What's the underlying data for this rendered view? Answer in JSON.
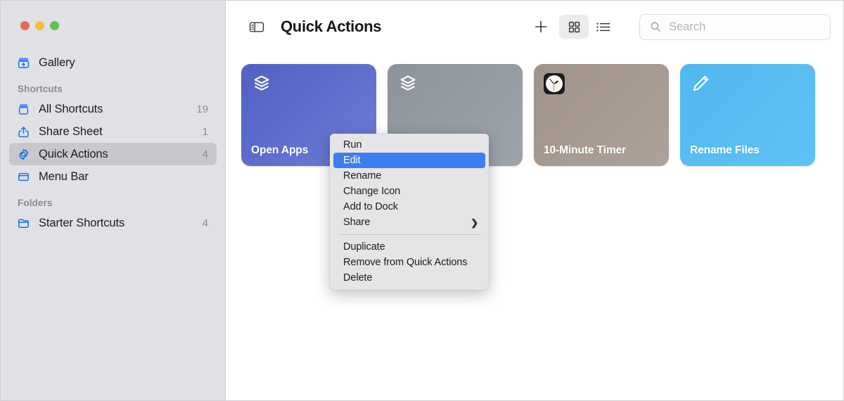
{
  "window": {
    "traffic_lights": [
      "close",
      "minimize",
      "zoom"
    ],
    "colors": {
      "sidebar_bg": "#e0e1e4",
      "sidebar_selected": "#c7c8cb",
      "accent_blue": "#1b72e8",
      "menu_highlight": "#3b7ff0",
      "menu_bg": "#e5e5e7"
    }
  },
  "sidebar": {
    "gallery": {
      "label": "Gallery",
      "icon": "gallery-icon"
    },
    "sections": [
      {
        "title": "Shortcuts",
        "items": [
          {
            "label": "All Shortcuts",
            "count": "19",
            "icon": "archive-box-icon",
            "selected": false
          },
          {
            "label": "Share Sheet",
            "count": "1",
            "icon": "share-icon",
            "selected": false
          },
          {
            "label": "Quick Actions",
            "count": "4",
            "icon": "gear-icon",
            "selected": true
          },
          {
            "label": "Menu Bar",
            "count": "",
            "icon": "menubar-icon",
            "selected": false
          }
        ]
      },
      {
        "title": "Folders",
        "items": [
          {
            "label": "Starter Shortcuts",
            "count": "4",
            "icon": "folder-icon",
            "selected": false
          }
        ]
      }
    ]
  },
  "toolbar": {
    "sidebar_toggle_icon": "sidebar-toggle-icon",
    "title": "Quick Actions",
    "add_icon": "plus-icon",
    "grid_view_icon": "grid-view-icon",
    "list_view_icon": "list-view-icon",
    "active_view": "grid",
    "search": {
      "icon": "search-icon",
      "placeholder": "Search",
      "value": ""
    }
  },
  "grid": {
    "tiles": [
      {
        "label": "Open Apps",
        "icon": "layers-icon",
        "color_start": "#5161c4",
        "color_end": "#6a79d4"
      },
      {
        "label": "",
        "icon": "layers-icon",
        "color_start": "#8d939b",
        "color_end": "#9ba1a8"
      },
      {
        "label": "10-Minute Timer",
        "icon": "clock-app-icon",
        "color_start": "#a3968e",
        "color_end": "#ab9f97"
      },
      {
        "label": "Rename Files",
        "icon": "pencil-icon",
        "color_start": "#4fb8f0",
        "color_end": "#5cc0f2"
      }
    ]
  },
  "context_menu": {
    "groups": [
      [
        {
          "label": "Run",
          "highlighted": false,
          "submenu": false
        },
        {
          "label": "Edit",
          "highlighted": true,
          "submenu": false
        },
        {
          "label": "Rename",
          "highlighted": false,
          "submenu": false
        },
        {
          "label": "Change Icon",
          "highlighted": false,
          "submenu": false
        },
        {
          "label": "Add to Dock",
          "highlighted": false,
          "submenu": false
        },
        {
          "label": "Share",
          "highlighted": false,
          "submenu": true,
          "arrow": "❯"
        }
      ],
      [
        {
          "label": "Duplicate",
          "highlighted": false,
          "submenu": false
        },
        {
          "label": "Remove from Quick Actions",
          "highlighted": false,
          "submenu": false
        },
        {
          "label": "Delete",
          "highlighted": false,
          "submenu": false
        }
      ]
    ]
  }
}
